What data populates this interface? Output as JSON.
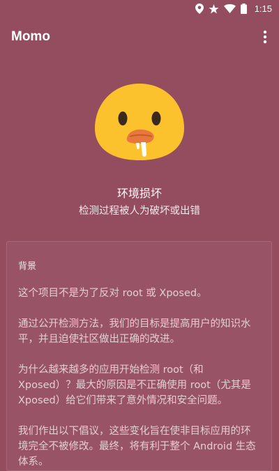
{
  "status_bar": {
    "time": "1:15",
    "icons": [
      "location-icon",
      "star-icon",
      "wifi-icon",
      "battery-icon"
    ]
  },
  "app_bar": {
    "title": "Momo",
    "menu_icon": "more-vert-icon"
  },
  "status": {
    "emoji": "drooling-face-emoji",
    "title": "环境损坏",
    "subtitle": "检测过程被人为破坏或出错"
  },
  "card": {
    "heading": "背景",
    "paragraphs": [
      "这个项目不是为了反对 root 或 Xposed。",
      "通过公开检测方法，我们的目标是提高用户的知识水平，并且迫使社区做出正确的改进。",
      "为什么越来越多的应用开始检测 root（和 Xposed）？最大的原因是不正确使用 root（尤其是 Xposed）给它们带来了意外情况和安全问题。",
      "我们作出以下倡议，这些变化旨在使非目标应用的环境完全不被修改。最终，将有利于整个 Android 生态体系。"
    ]
  },
  "colors": {
    "background": "#944c5f",
    "emoji_yellow": "#fbc22d",
    "emoji_mouth": "#e8773d"
  }
}
